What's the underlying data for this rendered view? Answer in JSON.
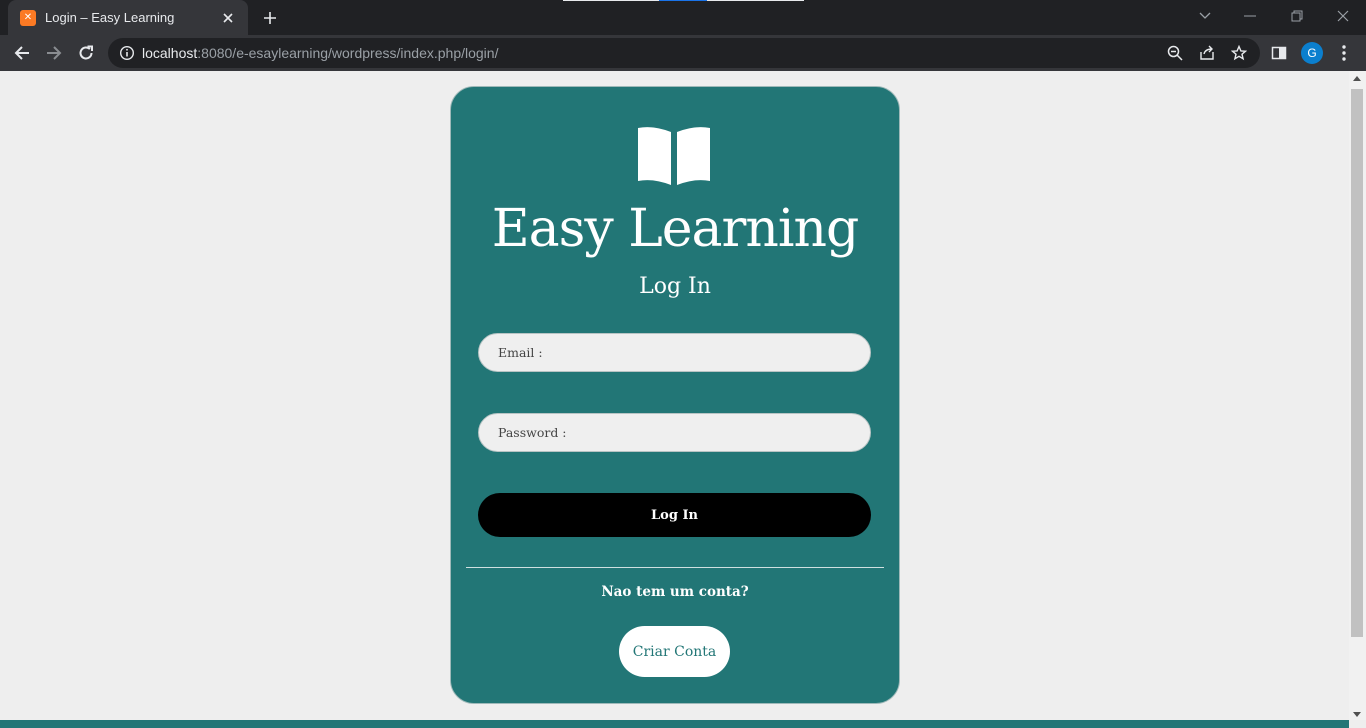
{
  "browser": {
    "tab": {
      "title": "Login – Easy Learning",
      "favicon_icon": "xampp-icon"
    },
    "url": {
      "host": "localhost",
      "path": ":8080/e-esaylearning/wordpress/index.php/login/"
    },
    "profile_initial": "G"
  },
  "card": {
    "logo_icon": "open-book-icon",
    "brand": "Easy Learning",
    "heading": "Log In",
    "email_placeholder": "Email :",
    "password_placeholder": "Password :",
    "login_button": "Log In",
    "no_account_text": "Nao tem um conta?",
    "create_account_button": "Criar Conta"
  },
  "colors": {
    "card_background": "#227676",
    "page_background": "#eeeeee",
    "login_button_background": "#000000",
    "create_button_text": "#227676"
  }
}
